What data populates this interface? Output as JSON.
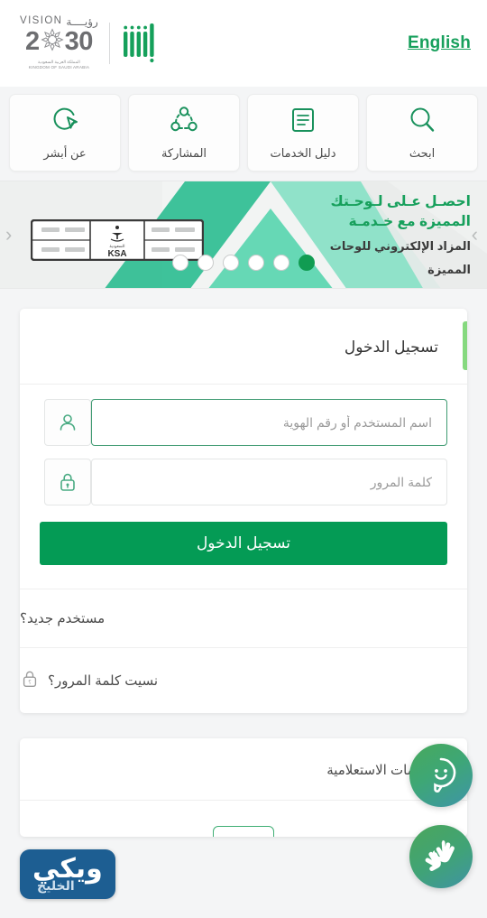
{
  "header": {
    "language_link": "English",
    "vision": {
      "word_en": "VISION",
      "word_ar": "رؤيــــة",
      "year_left": "2",
      "year_right": "30",
      "subtitle_ar": "المملكة العربية السعودية",
      "subtitle_en": "KINGDOM OF SAUDI ARABIA"
    },
    "absher_logo_name": "absher-logo"
  },
  "tiles": [
    {
      "label": "ابحث",
      "icon": "search-icon",
      "name": "search"
    },
    {
      "label": "دليل الخدمات",
      "icon": "services-guide-icon",
      "name": "services-guide"
    },
    {
      "label": "المشاركة",
      "icon": "share-icon",
      "name": "participation"
    },
    {
      "label": "عن أبشر",
      "icon": "about-absher-icon",
      "name": "about-absher"
    }
  ],
  "banner": {
    "headline": "احصـل عـلى لـوحـتك المميزة مع خـدمـة",
    "subline_1": "المزاد الإلكتروني للوحات",
    "subline_2": "المميزة",
    "plate_text": "KSA",
    "plate_sub_ar": "السعودية",
    "dots_total": 6,
    "active_dot": 1,
    "prev_arrow": "‹",
    "next_arrow": "›"
  },
  "login": {
    "title": "تسجيل الدخول",
    "username": {
      "placeholder": "اسم المستخدم أو رقم الهوية",
      "value": "",
      "icon": "user-icon",
      "focused": true
    },
    "password": {
      "placeholder": "كلمة المرور",
      "value": "",
      "icon": "lock-icon",
      "focused": false
    },
    "submit_label": "تسجيل الدخول",
    "new_user_label": "مستخدم جديد؟",
    "forgot_password_label": "نسيت كلمة المرور؟",
    "forgot_password_icon": "lock-question-icon"
  },
  "info_services": {
    "title": "الخدمات الاستعلامية"
  },
  "floating": [
    {
      "name": "chat-assistant-button",
      "icon": "chat-smiley-icon"
    },
    {
      "name": "sign-language-button",
      "icon": "sign-language-hands-icon"
    }
  ],
  "watermark": {
    "main": "ويكي",
    "sub": "الخليج"
  },
  "colors": {
    "brand_green": "#049b55",
    "accent_green": "#17a05c",
    "light_accent": "#86d97f",
    "page_bg": "#f4f5f6",
    "watermark_blue": "#1d5e92"
  }
}
